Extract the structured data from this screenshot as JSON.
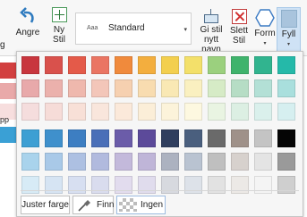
{
  "ribbon": {
    "left_edge_letter": "g",
    "undo_label": "Angre",
    "new_style_label_line1": "Ny",
    "new_style_label_line2": "Stil",
    "gallery_prefix": "Aaa",
    "gallery_value": "Standard",
    "give_style_label_line1": "Gi stil",
    "give_style_label_line2": "nytt navn",
    "delete_style_label_line1": "Slett",
    "delete_style_label_line2": "Stil",
    "form_label": "Form",
    "fill_label": "Fyll",
    "caret": "▾",
    "undo_icon_color": "#2f7bbf",
    "fill_swatch_color": "#a9c4dd"
  },
  "background_edge": {
    "letters": "pp"
  },
  "palette": {
    "rows": [
      [
        "#c8363e",
        "#d9514c",
        "#e45a49",
        "#ea7563",
        "#f08a3c",
        "#f3ae3e",
        "#f3cf4e",
        "#f3e06a",
        "#9bd07e",
        "#3fb36c",
        "#31b48f",
        "#25b9a9"
      ],
      [
        "#e8a9aa",
        "#ebb1ac",
        "#efb8ad",
        "#f3c6b9",
        "#f6d0b0",
        "#f8dcb0",
        "#f9e8b4",
        "#faf0c0",
        "#d6ebc6",
        "#b6ddc5",
        "#b3e0d6",
        "#a9dfdd"
      ],
      [
        "#f5dddd",
        "#f6dcd8",
        "#f8e0d7",
        "#f9e6dc",
        "#fbe9da",
        "#fbeed8",
        "#fcf3da",
        "#fdf8e0",
        "#e9f4e2",
        "#dcefe3",
        "#daf0ec",
        "#d6eff0"
      ],
      [
        "#3d9fd3",
        "#3f90cc",
        "#3d7ec2",
        "#4a6fb8",
        "#6b5ca9",
        "#5c4a9a",
        "#2f3e5e",
        "#4a5f7e",
        "#6a6a6a",
        "#9f9189",
        "#c4c4c4",
        "#050505"
      ],
      [
        "#a9d3ec",
        "#a9c9e8",
        "#adc0e2",
        "#b1bade",
        "#c3b9db",
        "#bfb5d8",
        "#acb2c0",
        "#b9c3d1",
        "#bfbfbf",
        "#d7d1cd",
        "#e4e4e4",
        "#9a9a9a"
      ],
      [
        "#d7ebf6",
        "#d6e4f3",
        "#d7dff1",
        "#d9dcee",
        "#e2dcee",
        "#e0dced",
        "#d7d9df",
        "#dde2e9",
        "#e2e2e2",
        "#ece9e6",
        "#f4f4f4",
        "#cfcfcf"
      ],
      [
        "#ffffff",
        "#ffffff",
        "#ffffff",
        "#ffffff",
        "#ffffff",
        "#ffffff",
        "#ffffff",
        "#ffffff",
        "#ffffff",
        "#ffffff",
        "#ffffff",
        "#ffffff"
      ]
    ]
  },
  "buttons": {
    "adjust_color": "Juster farge",
    "find": "Finn",
    "none": "Ingen"
  }
}
